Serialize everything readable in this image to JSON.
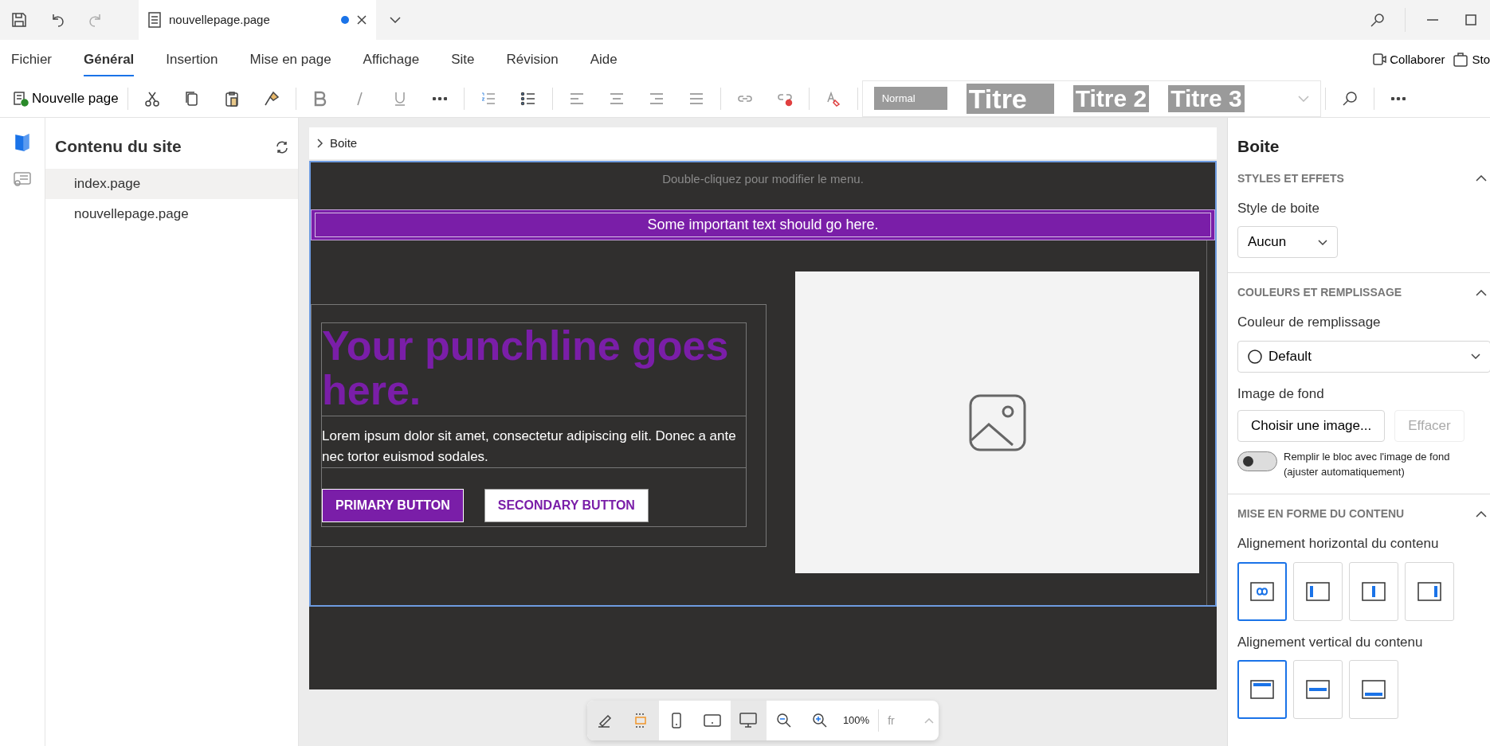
{
  "title_bar": {
    "tab": {
      "title": "nouvellepage.page",
      "unsaved": true
    }
  },
  "ribbon_tabs": [
    {
      "label": "Fichier",
      "selected": false
    },
    {
      "label": "Général",
      "selected": true
    },
    {
      "label": "Insertion",
      "selected": false
    },
    {
      "label": "Mise en page",
      "selected": false
    },
    {
      "label": "Affichage",
      "selected": false
    },
    {
      "label": "Site",
      "selected": false
    },
    {
      "label": "Révision",
      "selected": false
    },
    {
      "label": "Aide",
      "selected": false
    }
  ],
  "ribbon_actions": [
    "Collaborer",
    "Sto"
  ],
  "toolbar": {
    "new_page": "Nouvelle page",
    "styles": [
      "Normal",
      "Titre",
      "Titre 2",
      "Titre 3"
    ]
  },
  "sidebar": {
    "title": "Contenu du site",
    "items": [
      {
        "label": "index.page",
        "selected": true
      },
      {
        "label": "nouvellepage.page",
        "selected": false
      }
    ]
  },
  "breadcrumb": "Boite",
  "canvas": {
    "menu_hint": "Double-cliquez pour modifier le menu.",
    "banner": "Some important text should go here.",
    "headline": "Your punchline goes here.",
    "body": "Lorem ipsum dolor sit amet, consectetur adipiscing elit. Donec a ante nec tortor euismod sodales.",
    "primary_button": "PRIMARY BUTTON",
    "secondary_button": "SECONDARY BUTTON"
  },
  "bottom_toolbar": {
    "frame_guides": true,
    "views": [
      {
        "kind": "phone",
        "selected": false
      },
      {
        "kind": "tablet",
        "selected": false
      },
      {
        "kind": "desktop",
        "selected": true
      }
    ],
    "zoom": "100%",
    "language": "fr"
  },
  "properties": {
    "title": "Boite",
    "sections": [
      {
        "heading": "STYLES ET EFFETS"
      },
      {
        "heading": "COULEURS ET REMPLISSAGE"
      },
      {
        "heading": "MISE EN FORME DU CONTENU"
      }
    ],
    "box_style_label": "Style de boite",
    "box_style": "Aucun",
    "fill_label": "Couleur de remplissage",
    "fill": "Default",
    "image_label": "Image de fond",
    "choose_image": "Choisir une image...",
    "clear_image": "Effacer",
    "fit_toggle": {
      "on": false,
      "label": "Remplir le bloc avec l'image de fond (ajuster automatiquement)"
    },
    "h_align_label": "Alignement horizontal du contenu",
    "h_align": [
      {
        "kind": "stretch",
        "selected": true
      },
      {
        "kind": "left",
        "selected": false
      },
      {
        "kind": "center",
        "selected": false
      },
      {
        "kind": "right",
        "selected": false
      }
    ],
    "v_align_label": "Alignement vertical du contenu",
    "v_align": [
      {
        "kind": "top",
        "selected": true
      },
      {
        "kind": "middle",
        "selected": false
      },
      {
        "kind": "bottom",
        "selected": false
      }
    ]
  }
}
